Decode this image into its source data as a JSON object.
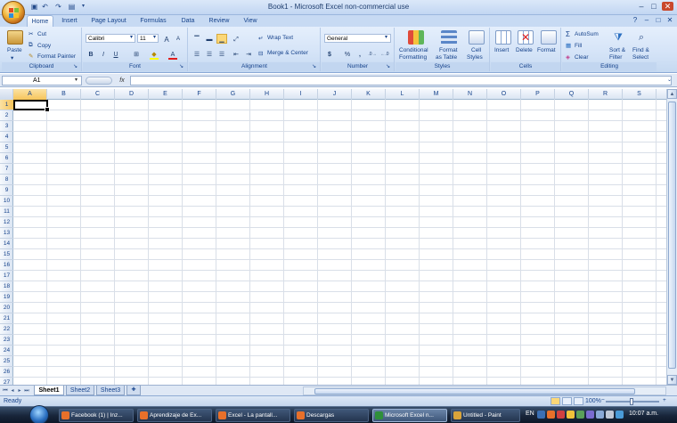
{
  "window": {
    "title": "Book1 - Microsoft Excel non-commercial use"
  },
  "tabs": [
    "Home",
    "Insert",
    "Page Layout",
    "Formulas",
    "Data",
    "Review",
    "View"
  ],
  "clipboard": {
    "paste": "Paste",
    "cut": "Cut",
    "copy": "Copy",
    "format_painter": "Format Painter",
    "label": "Clipboard"
  },
  "font": {
    "name": "Calibri",
    "size": "11",
    "label": "Font",
    "bold": "B",
    "italic": "I",
    "underline": "U",
    "grow": "A",
    "shrink": "A",
    "color_a": "A"
  },
  "alignment": {
    "wrap": "Wrap Text",
    "merge": "Merge & Center",
    "label": "Alignment"
  },
  "number": {
    "format": "General",
    "currency": "$",
    "percent": "%",
    "comma": ",",
    "label": "Number"
  },
  "styles": {
    "conditional": "Conditional",
    "conditional2": "Formatting",
    "format_table": "Format",
    "format_table2": "as Table",
    "cell_styles": "Cell",
    "cell_styles2": "Styles",
    "label": "Styles"
  },
  "cells_grp": {
    "insert": "Insert",
    "delete": "Delete",
    "format": "Format",
    "label": "Cells"
  },
  "editing": {
    "autosum": "AutoSum",
    "fill": "Fill",
    "clear": "Clear",
    "sort": "Sort &",
    "sort2": "Filter",
    "find": "Find &",
    "find2": "Select",
    "label": "Editing"
  },
  "formula_bar": {
    "name_box": "A1",
    "fx": "fx",
    "formula": ""
  },
  "columns": [
    "A",
    "B",
    "C",
    "D",
    "E",
    "F",
    "G",
    "H",
    "I",
    "J",
    "K",
    "L",
    "M",
    "N",
    "O",
    "P",
    "Q",
    "R",
    "S"
  ],
  "rows": [
    "1",
    "2",
    "3",
    "4",
    "5",
    "6",
    "7",
    "8",
    "9",
    "10",
    "11",
    "12",
    "13",
    "14",
    "15",
    "16",
    "17",
    "18",
    "19",
    "20",
    "21",
    "22",
    "23",
    "24",
    "25",
    "26",
    "27"
  ],
  "sheets": [
    "Sheet1",
    "Sheet2",
    "Sheet3"
  ],
  "status": {
    "text": "Ready",
    "zoom": "100%"
  },
  "taskbar": {
    "items": [
      "Facebook (1) | Inz...",
      "Aprendizaje de Ex...",
      "Excel - La pantall...",
      "Descargas",
      "Microsoft Excel n...",
      "Untitled - Paint"
    ],
    "lang": "EN",
    "clock": "10:07 a.m."
  },
  "colors": {
    "ribbon": "#d4e3f7",
    "accent": "#15428b",
    "taskbar": "#18253a"
  }
}
